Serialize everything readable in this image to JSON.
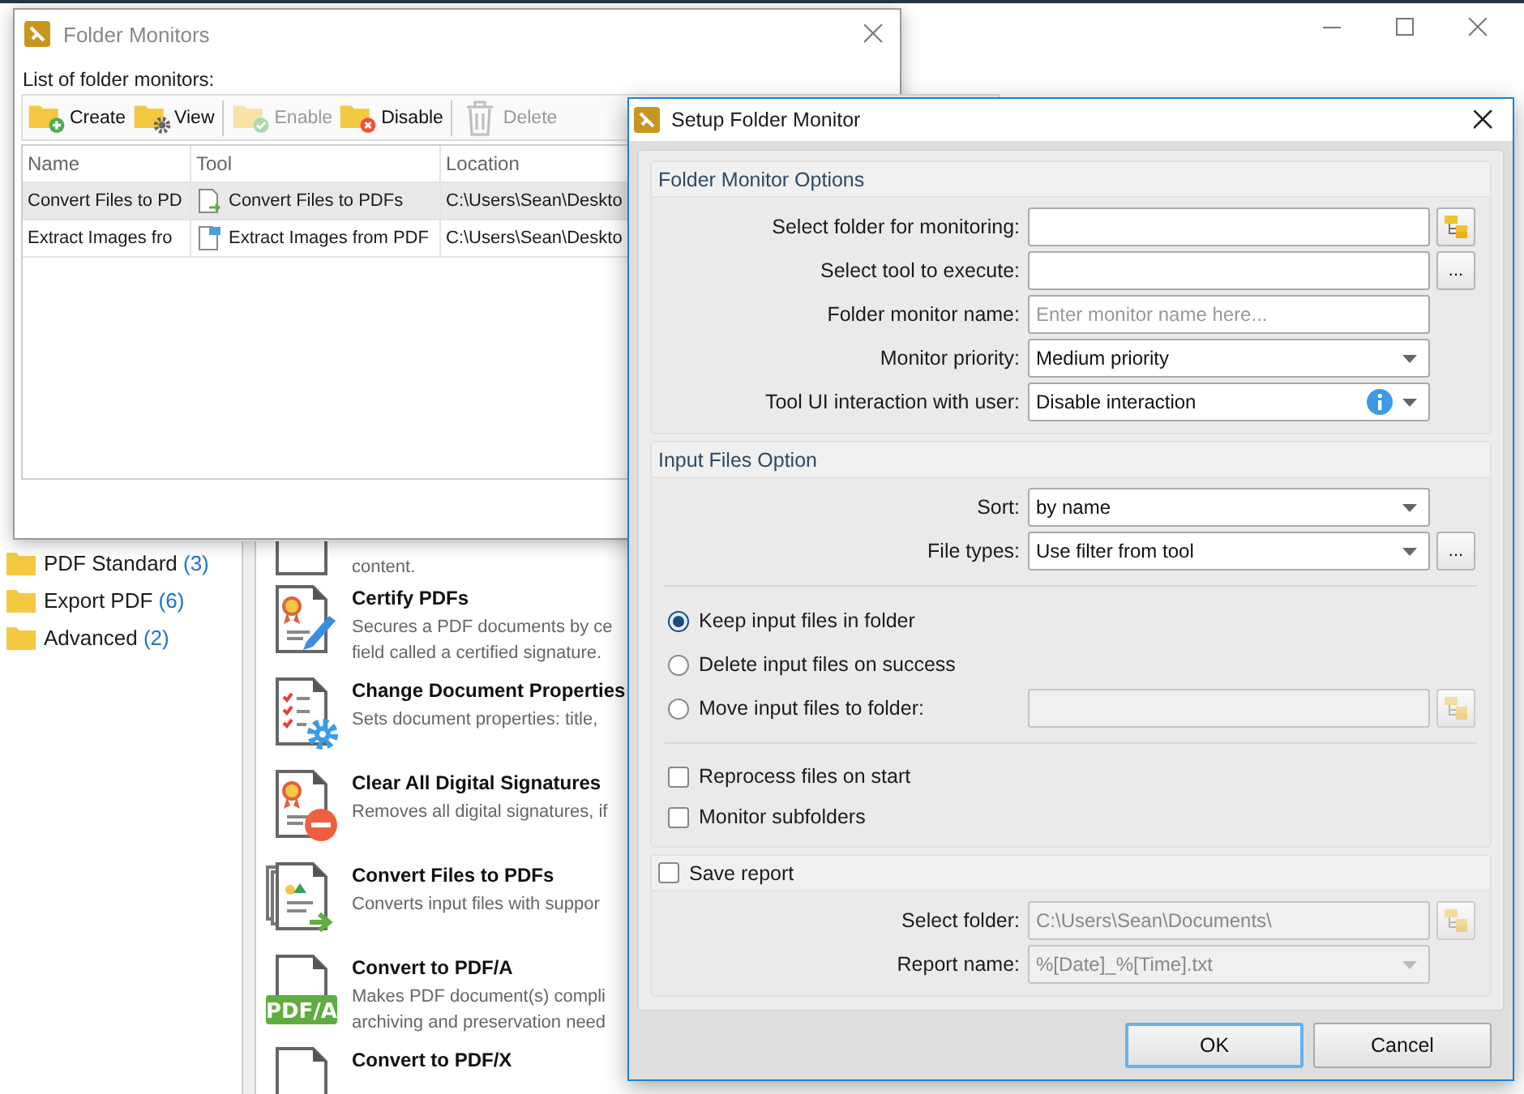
{
  "main_window": {
    "categories": [
      {
        "label": "PDF Standard",
        "count": "(3)"
      },
      {
        "label": "Export PDF",
        "count": "(6)"
      },
      {
        "label": "Advanced",
        "count": "(2)"
      }
    ],
    "tools": [
      {
        "kind": "add",
        "description": [
          "content."
        ]
      },
      {
        "kind": "certify",
        "title": "Certify PDFs",
        "description": [
          "Secures a PDF documents by ce",
          "field called a certified signature."
        ]
      },
      {
        "kind": "properties",
        "title": "Change Document Properties",
        "description": [
          "Sets document properties: title,"
        ]
      },
      {
        "kind": "clear",
        "title": "Clear All Digital Signatures",
        "description": [
          "Removes all digital signatures, if"
        ]
      },
      {
        "kind": "convert",
        "title": "Convert Files to PDFs",
        "description": [
          "Converts input files with suppor"
        ]
      },
      {
        "kind": "pdfa",
        "badge": "PDF/A",
        "title": "Convert to PDF/A",
        "description": [
          "Makes PDF document(s) compli",
          "archiving and preservation need"
        ]
      },
      {
        "kind": "pdfx",
        "title": "Convert to PDF/X"
      }
    ]
  },
  "folder_monitors": {
    "title": "Folder Monitors",
    "list_label": "List of folder monitors:",
    "toolbar": [
      {
        "kind": "create",
        "label": "Create",
        "disabled": false
      },
      {
        "kind": "view",
        "label": "View",
        "disabled": false
      },
      {
        "kind": "enable",
        "label": "Enable",
        "disabled": true,
        "separator_before": true
      },
      {
        "kind": "disable",
        "label": "Disable",
        "disabled": false
      },
      {
        "kind": "delete",
        "label": "Delete",
        "disabled": true,
        "separator_before": true
      }
    ],
    "columns": [
      "Name",
      "Tool",
      "Location"
    ],
    "rows": [
      {
        "name": "Convert Files to PD",
        "tool": "Convert Files to PDFs",
        "kind": "convert",
        "location": "C:\\Users\\Sean\\Deskto",
        "selected": true
      },
      {
        "name": "Extract Images fro",
        "tool": "Extract Images from PDF",
        "kind": "extract",
        "location": "C:\\Users\\Sean\\Deskto",
        "selected": false
      }
    ]
  },
  "setup": {
    "title": "Setup Folder Monitor",
    "options": {
      "heading": "Folder Monitor Options",
      "fields": [
        {
          "label": "Select folder for monitoring:",
          "kind": "text",
          "button": {
            "kind": "folder"
          }
        },
        {
          "label": "Select tool to execute:",
          "kind": "text",
          "button": {
            "kind": "dots",
            "label": "..."
          }
        },
        {
          "label": "Folder monitor name:",
          "kind": "text",
          "placeholder": "Enter monitor name here..."
        },
        {
          "label": "Monitor priority:",
          "kind": "dropdown",
          "value": "Medium priority"
        },
        {
          "label": "Tool UI interaction with user:",
          "kind": "dropdown",
          "value": "Disable interaction",
          "info": true
        }
      ]
    },
    "input_files": {
      "heading": "Input Files Option",
      "fields": [
        {
          "label": "Sort:",
          "kind": "dropdown",
          "value": "by name"
        },
        {
          "label": "File types:",
          "kind": "dropdown",
          "value": "Use filter from tool",
          "button": {
            "kind": "dots",
            "label": "..."
          }
        }
      ],
      "radios": [
        {
          "label": "Keep input files in folder",
          "selected": true
        },
        {
          "label": "Delete input files on success",
          "selected": false
        },
        {
          "label": "Move input files to folder:",
          "selected": false,
          "field": {
            "kind": "text",
            "disabled": true,
            "button": {
              "kind": "folder"
            }
          }
        }
      ],
      "checkboxes": [
        {
          "label": "Reprocess files on start",
          "checked": false
        },
        {
          "label": "Monitor subfolders",
          "checked": false
        }
      ]
    },
    "report": {
      "label": "Save report",
      "checked": false,
      "fields": [
        {
          "label": "Select folder:",
          "kind": "text",
          "value": "C:\\Users\\Sean\\Documents\\",
          "disabled": true,
          "button": {
            "kind": "folder"
          }
        },
        {
          "label": "Report name:",
          "kind": "dropdown",
          "value": "%[Date]_%[Time].txt",
          "disabled": true
        }
      ]
    },
    "buttons": [
      {
        "label": "OK",
        "default": true
      },
      {
        "label": "Cancel",
        "default": false
      }
    ]
  }
}
